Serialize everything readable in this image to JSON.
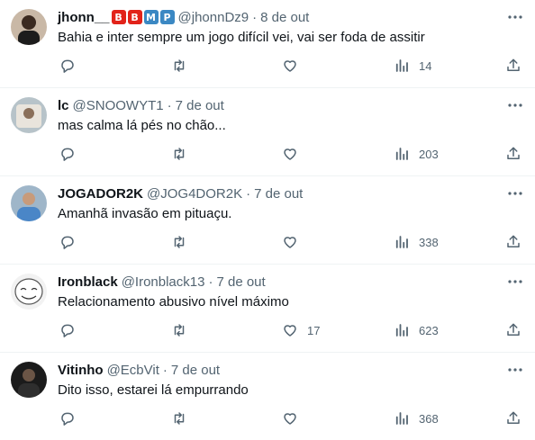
{
  "tweets": [
    {
      "name": "jhonn__",
      "badges": [
        "B",
        "B",
        "M",
        "P"
      ],
      "handle": "@jhonnDz9",
      "separator": "·",
      "time": "8 de out",
      "text": "Bahia e inter sempre um jogo difícil vei, vai ser foda de assitir",
      "replies": "",
      "retweets": "",
      "likes": "",
      "views": "14"
    },
    {
      "name": "lc",
      "handle": "@SNOOWYT1",
      "separator": "·",
      "time": "7 de out",
      "text": "mas calma lá pés no chão...",
      "replies": "",
      "retweets": "",
      "likes": "",
      "views": "203"
    },
    {
      "name": "JOGADOR2K",
      "handle": "@JOG4DOR2K",
      "separator": "·",
      "time": "7 de out",
      "text": "Amanhã invasão em pituaçu.",
      "replies": "",
      "retweets": "",
      "likes": "",
      "views": "338"
    },
    {
      "name": "Ironblack",
      "handle": "@Ironblack13",
      "separator": "·",
      "time": "7 de out",
      "text": "Relacionamento abusivo nível máximo",
      "replies": "",
      "retweets": "",
      "likes": "17",
      "views": "623"
    },
    {
      "name": "Vitinho",
      "handle": "@EcbVit",
      "separator": "·",
      "time": "7 de out",
      "text": "Dito isso, estarei lá empurrando",
      "replies": "",
      "retweets": "",
      "likes": "",
      "views": "368"
    }
  ],
  "colors": {
    "text": "#0f1419",
    "secondary": "#536471",
    "divider": "#eff3f4",
    "badge_red": "#e2231a",
    "badge_blue": "#3b88c3"
  },
  "icons": {
    "reply": "reply-icon",
    "retweet": "retweet-icon",
    "like": "heart-icon",
    "views": "views-icon",
    "share": "share-icon",
    "more": "more-icon"
  }
}
